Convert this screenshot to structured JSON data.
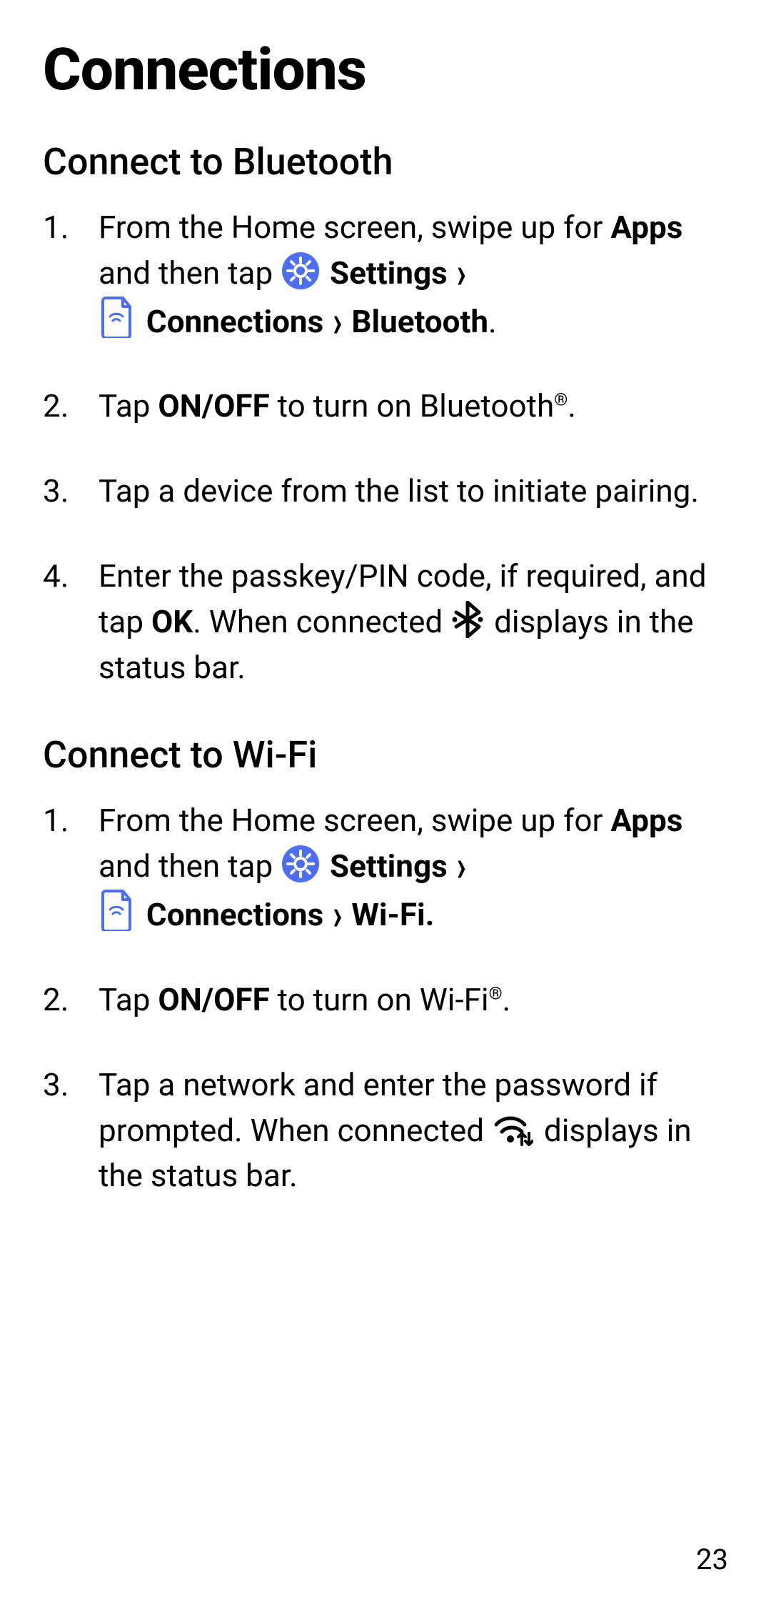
{
  "title": "Connections",
  "page_number": "23",
  "sections": [
    {
      "heading": "Connect to Bluetooth",
      "steps": [
        {
          "pre_apps": "From the Home screen, swipe up for ",
          "apps": "Apps",
          "post_apps": " and then tap ",
          "settings_label": "Settings",
          "connections_label": "Connections",
          "final_label": "Bluetooth",
          "final_punct": "."
        },
        {
          "pre": "Tap ",
          "bold": "ON/OFF",
          "post": " to turn on Bluetooth",
          "reg": "®",
          "tail": "."
        },
        {
          "text": "Tap a device from the list to initiate pairing."
        },
        {
          "pre_ok": "Enter the passkey/PIN code, if required, and tap ",
          "ok": "OK",
          "mid": ". When connected ",
          "tail": "displays in the status bar."
        }
      ]
    },
    {
      "heading": "Connect to Wi-Fi",
      "steps": [
        {
          "pre_apps": "From the Home screen, swipe up for ",
          "apps": "Apps",
          "post_apps": " and then tap ",
          "settings_label": "Settings",
          "connections_label": "Connections",
          "final_label": "Wi-Fi.",
          "final_punct": ""
        },
        {
          "pre": "Tap ",
          "bold": "ON/OFF",
          "post": " to turn on Wi-Fi",
          "reg": "®",
          "tail": "."
        },
        {
          "pre": "Tap a network and enter the password if prompted. When connected ",
          "tail": " displays in the status bar."
        }
      ]
    }
  ],
  "glyphs": {
    "chevron": "›"
  }
}
